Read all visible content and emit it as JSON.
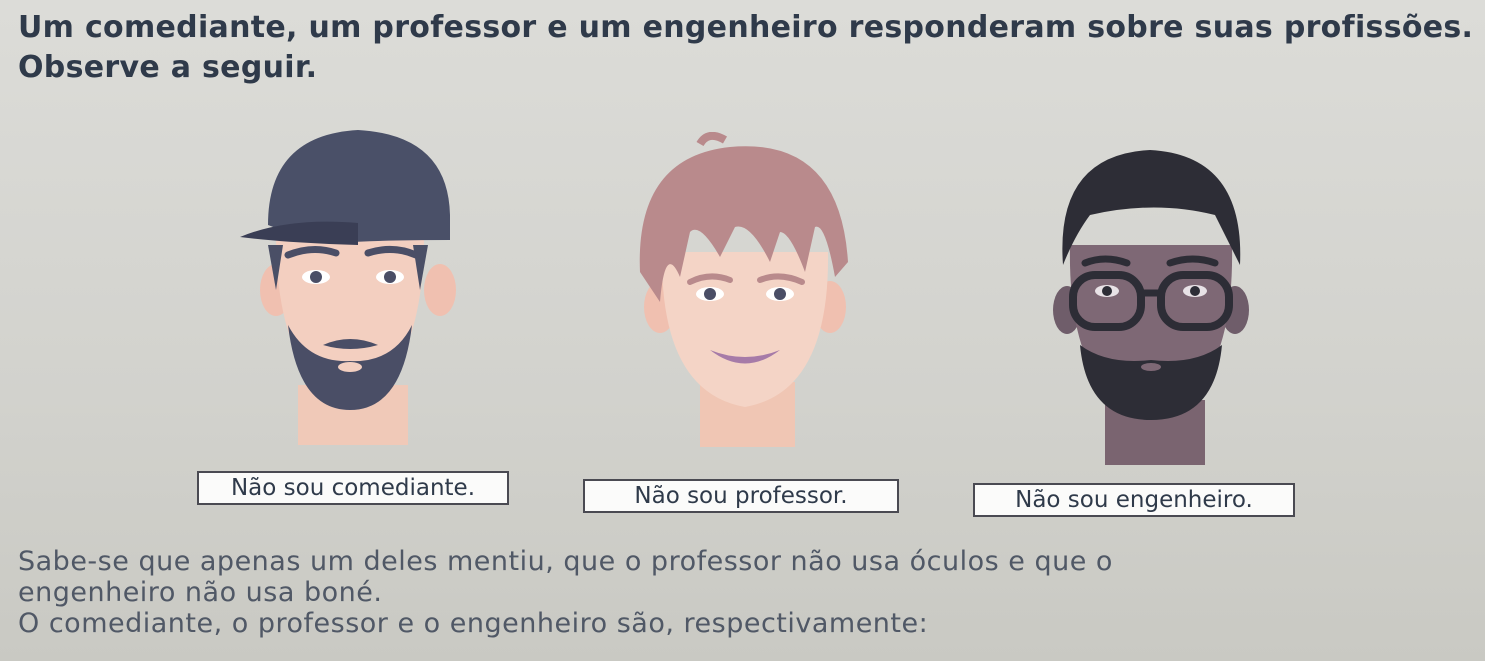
{
  "intro": {
    "line1": "Um comediante, um professor e um engenheiro responderam sobre suas profissões.",
    "line2": "Observe a seguir."
  },
  "faces": [
    {
      "icon": "bearded-man-with-cap-icon",
      "statement": "Não sou comediante."
    },
    {
      "icon": "smiling-young-man-icon",
      "statement": "Não sou professor."
    },
    {
      "icon": "bearded-man-with-glasses-icon",
      "statement": "Não sou engenheiro."
    }
  ],
  "question": {
    "line1": "Sabe-se que apenas um deles mentiu, que o professor não usa óculos e que o",
    "line2": "engenheiro não usa boné.",
    "line3": "O comediante, o professor e o engenheiro são, respectivamente:"
  }
}
